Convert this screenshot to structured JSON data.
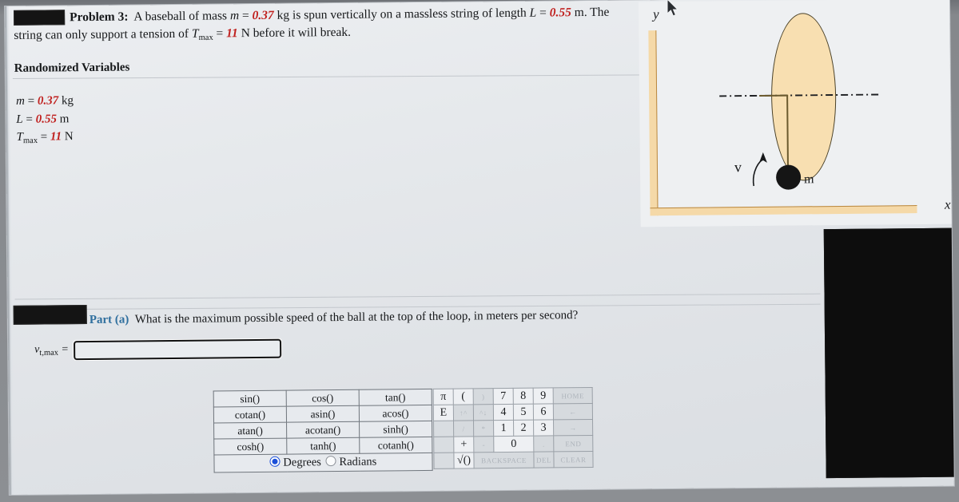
{
  "problem": {
    "redacted_box": "",
    "label": "Problem 3:",
    "line1_a": "A baseball of mass ",
    "var_m": "m",
    "eq1": " = ",
    "val_m": "0.37",
    "line1_b": " kg is spun vertically on a massless string of length ",
    "var_L": "L",
    "eq2": " = ",
    "val_L": "0.55",
    "line2_a": " m. The string can only support a tension of ",
    "var_T": "T",
    "var_T_sub": "max",
    "eq3": " = ",
    "val_T": "11",
    "line2_b": " N before it will break."
  },
  "randomized": {
    "heading": "Randomized Variables",
    "rows": [
      {
        "symbol": "m",
        "sub": "",
        "eq": " = ",
        "value": "0.37",
        "unit": " kg"
      },
      {
        "symbol": "L",
        "sub": "",
        "eq": " = ",
        "value": "0.55",
        "unit": " m"
      },
      {
        "symbol": "T",
        "sub": "max",
        "eq": " = ",
        "value": "11",
        "unit": " N"
      }
    ]
  },
  "part_a": {
    "label": "Part (a)",
    "question": "What is the maximum possible speed of the ball at the top of the loop, in meters per second?",
    "answer_label_main": "v",
    "answer_label_sub": "t,max",
    "answer_label_eq": " =",
    "answer_value": "",
    "answer_placeholder": ""
  },
  "figure": {
    "y_axis_label": "y",
    "x_axis_label": "x",
    "mass_label": "m",
    "velocity_label": "v",
    "loop_color": "#f8dfb1",
    "axis_color": "#f5d9a8",
    "ball_color": "#151515"
  },
  "keypad": {
    "functions": [
      [
        "sin()",
        "cos()",
        "tan()"
      ],
      [
        "cotan()",
        "asin()",
        "acos()"
      ],
      [
        "atan()",
        "acotan()",
        "sinh()"
      ],
      [
        "cosh()",
        "tanh()",
        "cotanh()"
      ]
    ],
    "modes": {
      "degrees": "Degrees",
      "radians": "Radians",
      "selected": "Degrees"
    },
    "pad": [
      [
        "π",
        "(",
        ")",
        "7",
        "8",
        "9",
        "HOME"
      ],
      [
        "E",
        "↑^",
        "^↓",
        "4",
        "5",
        "6",
        "←"
      ],
      [
        "",
        "/",
        "*",
        "1",
        "2",
        "3",
        "→"
      ],
      [
        "",
        "+",
        "-",
        "0",
        ".",
        "END"
      ],
      [
        "",
        "√()",
        "BACKSPACE",
        "DEL",
        "CLEAR"
      ]
    ],
    "accent_color": "#1b4fd8"
  }
}
